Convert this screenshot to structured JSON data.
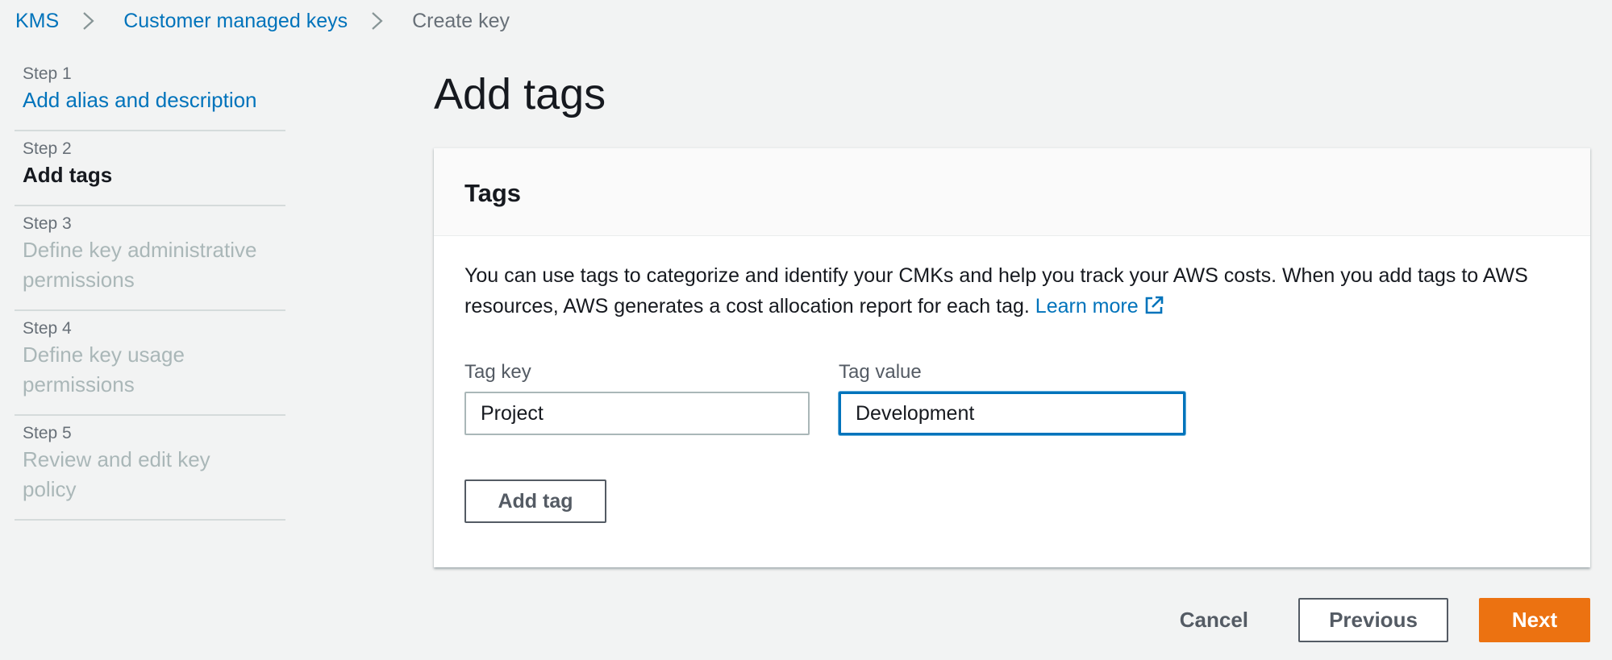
{
  "breadcrumb": {
    "items": [
      "KMS",
      "Customer managed keys"
    ],
    "current": "Create key"
  },
  "steps": [
    {
      "num": "Step 1",
      "title": "Add alias and description",
      "state": "done"
    },
    {
      "num": "Step 2",
      "title": "Add tags",
      "state": "current"
    },
    {
      "num": "Step 3",
      "title": "Define key administrative permissions",
      "state": "upcoming"
    },
    {
      "num": "Step 4",
      "title": "Define key usage permissions",
      "state": "upcoming"
    },
    {
      "num": "Step 5",
      "title": "Review and edit key policy",
      "state": "upcoming"
    }
  ],
  "page": {
    "title": "Add tags"
  },
  "panel": {
    "heading": "Tags",
    "description": "You can use tags to categorize and identify your CMKs and help you track your AWS costs. When you add tags to AWS resources, AWS generates a cost allocation report for each tag.",
    "learn_more": "Learn more",
    "tag_key_label": "Tag key",
    "tag_key_value": "Project",
    "tag_value_label": "Tag value",
    "tag_value_value": "Development",
    "add_tag": "Add tag"
  },
  "actions": {
    "cancel": "Cancel",
    "previous": "Previous",
    "next": "Next"
  },
  "colors": {
    "link": "#0073bb",
    "primary": "#ec7211",
    "background": "#f2f3f3"
  }
}
